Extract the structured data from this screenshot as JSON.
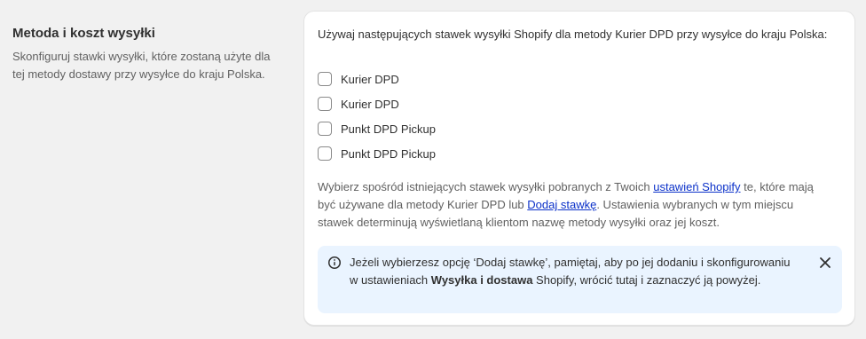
{
  "section": {
    "title": "Metoda i koszt wysyłki",
    "description": "Skonfiguruj stawki wysyłki, które zostaną użyte dla tej metody dostawy przy wysyłce do kraju Polska."
  },
  "card": {
    "intro": "Używaj następujących stawek wysyłki Shopify dla metody Kurier DPD przy wysyłce do kraju Polska:",
    "options": [
      {
        "label": "Kurier DPD",
        "checked": false
      },
      {
        "label": "Kurier DPD",
        "checked": false
      },
      {
        "label": "Punkt DPD Pickup",
        "checked": false
      },
      {
        "label": "Punkt DPD Pickup",
        "checked": false
      }
    ],
    "help": {
      "part1": "Wybierz spośród istniejących stawek wysyłki pobranych z Twoich ",
      "link1": "ustawień Shopify",
      "part2": " te, które mają być używane dla metody Kurier DPD lub ",
      "link2": "Dodaj stawkę",
      "part3": ". Ustawienia wybranych w tym miejscu stawek determinują wyświetlaną klientom nazwę metody wysyłki oraz jej koszt."
    },
    "banner": {
      "part1": "Jeżeli wybierzesz opcję ‘Dodaj stawkę’, pamiętaj, aby po jej dodaniu i skonfigurowaniu w ustawieniach ",
      "bold": "Wysyłka i dostawa",
      "part2": " Shopify, wrócić tutaj i zaznaczyć ją powyżej.",
      "icon": "info-icon",
      "close_icon": "close-icon"
    }
  },
  "colors": {
    "page_bg": "#f1f1f1",
    "card_bg": "#ffffff",
    "banner_bg": "#eaf4ff",
    "link": "#0b31c9"
  }
}
